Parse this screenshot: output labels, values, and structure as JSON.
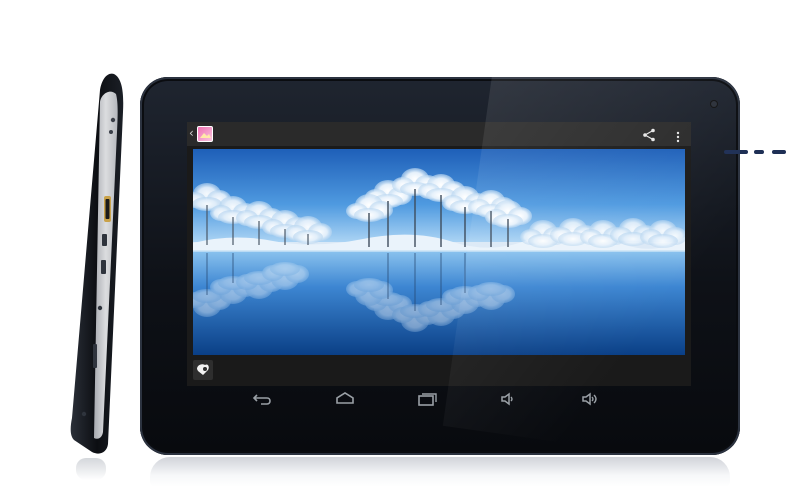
{
  "image": {
    "subject": "",
    "accent_colors": {
      "bezel": "#0e1117",
      "sky": "#2f7fd0",
      "water": "#0e4c92",
      "frost": "#e8f2fb",
      "nav_icon": "#9aa0a6"
    }
  },
  "screen": {
    "action_bar": {
      "back_glyph": "‹",
      "app_icon": "gallery-icon",
      "actions": [
        "share-icon",
        "overflow-menu-icon"
      ]
    },
    "photo": {
      "scene": ""
    },
    "bottom_left_tool": "photo-editor-icon"
  },
  "navigation_bar": {
    "buttons": [
      "back-icon",
      "home-icon",
      "recent-apps-icon",
      "volume-down-icon",
      "volume-up-icon"
    ]
  },
  "side_profile": {
    "ports": [
      "power-button-icon",
      "hdmi-port-icon",
      "usb-port-icon",
      "headphone-jack-icon",
      "card-slot-icon",
      "dc-in-icon"
    ]
  }
}
